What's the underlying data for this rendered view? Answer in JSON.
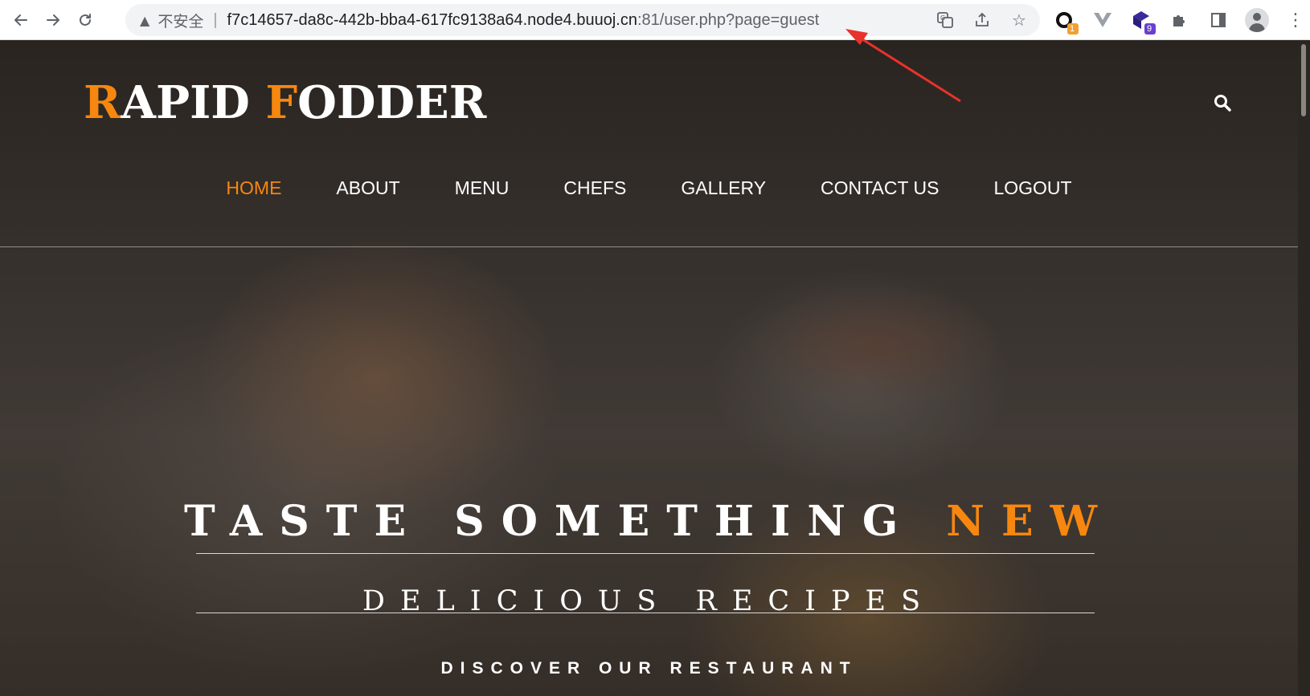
{
  "browser": {
    "insecure_label": "不安全",
    "url_main": "f7c14657-da8c-442b-bba4-617fc9138a64.node4.buuoj.cn",
    "url_rest": ":81/user.php?page=guest",
    "extensions": [
      {
        "icon": "ring-extension-icon",
        "badge": "1",
        "badge_color": "#f0a030"
      },
      {
        "icon": "v-extension-icon",
        "badge": ""
      },
      {
        "icon": "cube-extension-icon",
        "badge": "9",
        "badge_color": "#6a3fd0"
      }
    ]
  },
  "site": {
    "brand_first_initial": "R",
    "brand_first_rest": "APID ",
    "brand_second_initial": "F",
    "brand_second_rest": "ODDER",
    "nav": [
      {
        "label": "HOME",
        "active": true
      },
      {
        "label": "ABOUT"
      },
      {
        "label": "MENU"
      },
      {
        "label": "CHEFS"
      },
      {
        "label": "GALLERY"
      },
      {
        "label": "CONTACT US"
      },
      {
        "label": "LOGOUT"
      }
    ],
    "hero": {
      "title_main": "TASTE SOMETHING ",
      "title_accent": "NEW",
      "subtitle": "DELICIOUS RECIPES",
      "tagline": "DISCOVER OUR RESTAURANT"
    }
  },
  "colors": {
    "accent": "#f7870f",
    "annotation_arrow": "#e8322b"
  }
}
